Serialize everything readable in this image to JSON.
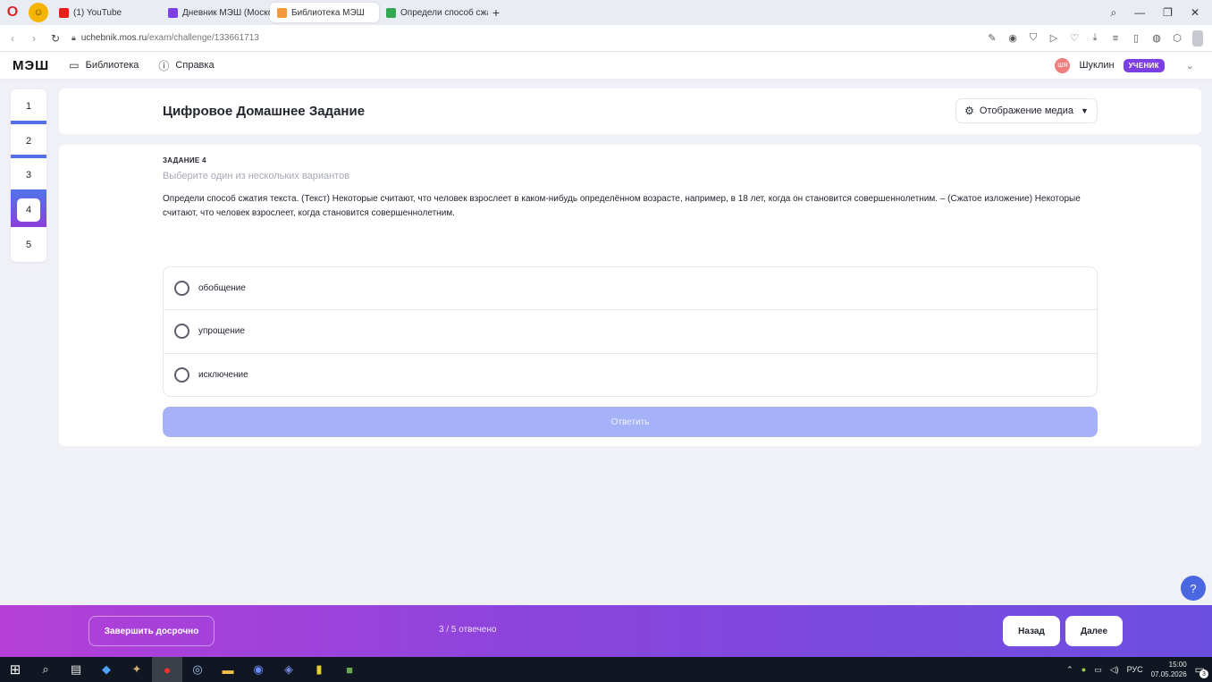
{
  "browser": {
    "tabs": [
      {
        "label": "(1) YouTube",
        "color": "#e62117"
      },
      {
        "label": "Дневник МЭШ (Москов",
        "color": "#7b3fe4"
      },
      {
        "label": "Библиотека МЭШ",
        "color": "#f49a3c"
      },
      {
        "label": "Определи способ сжати",
        "color": "#34a853"
      }
    ],
    "url_host": "uchebnik.mos.ru",
    "url_path": "/exam/challenge/133661713"
  },
  "header": {
    "logo": "МЭШ",
    "library_label": "Библиотека",
    "help_label": "Справка",
    "avatar_initials": "ШЯ",
    "user_name": "Шуклин",
    "role_badge": "УЧЕНИК"
  },
  "qnav": [
    "1",
    "2",
    "3",
    "4",
    "5"
  ],
  "page": {
    "title": "Цифровое Домашнее Задание",
    "media_button": "Отображение медиа"
  },
  "task": {
    "label": "ЗАДАНИЕ 4",
    "hint": "Выберите один из нескольких вариантов",
    "text": "Определи способ сжатия текста. (Текст) Некоторые считают, что человек взрослеет в каком-нибудь определённом возрасте, например, в 18 лет, когда он становится совершеннолетним. – (Сжатое изложение) Некоторые считают, что человек взрослеет, когда становится совершеннолетним.",
    "options": [
      "обобщение",
      "упрощение",
      "исключение"
    ],
    "answer_button": "Ответить"
  },
  "help_button": "?",
  "footer": {
    "finish_button": "Завершить досрочно",
    "progress": "3 / 5 отвечено",
    "back_button": "Назад",
    "next_button": "Далее"
  },
  "taskbar": {
    "lang": "РУС",
    "time": "15:00",
    "date": "07.05.2026",
    "notifications": "3"
  },
  "colors": {
    "accent": "#7b3fe4",
    "progress_blue": "#5570e8",
    "answer_disabled": "#a5b2f7",
    "footer_gradient_start": "#b43fd8",
    "footer_gradient_end": "#6b4fe0"
  }
}
